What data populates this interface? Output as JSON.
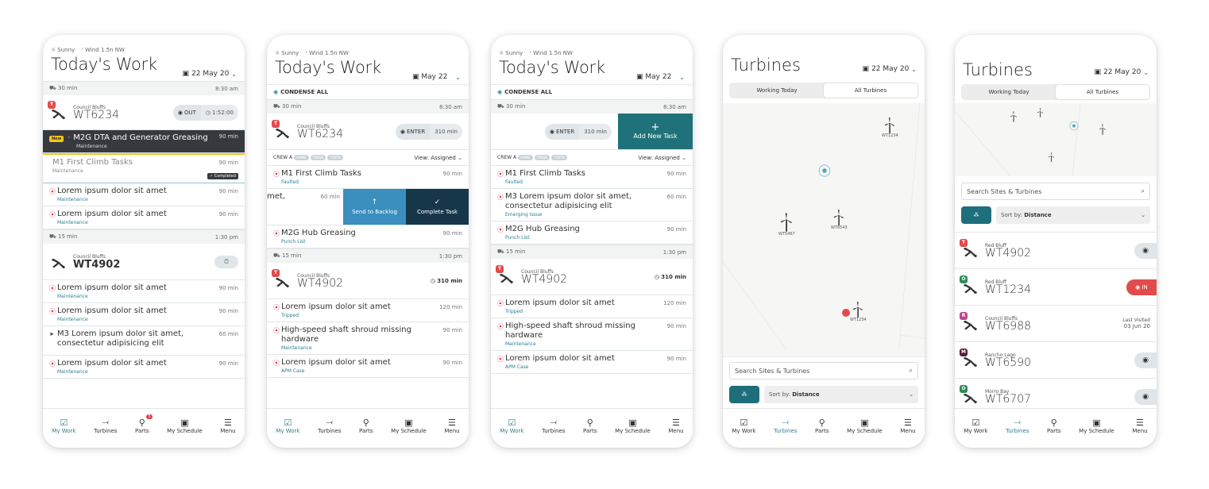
{
  "weather": {
    "condition": "Sunny",
    "wind": "Wind 1.5n NW"
  },
  "nav": {
    "items": [
      {
        "label": "My Work",
        "icon": "check-square-icon"
      },
      {
        "label": "Turbines",
        "icon": "turbine-icon"
      },
      {
        "label": "Parts",
        "icon": "wrench-icon",
        "badge": "5"
      },
      {
        "label": "My Schedule",
        "icon": "calendar-icon"
      },
      {
        "label": "Menu",
        "icon": "menu-icon"
      }
    ]
  },
  "screen1": {
    "title": "Today's Work",
    "date": "22 May 20",
    "travel1": {
      "duration": "30 min",
      "time": "8:30 am"
    },
    "turbine1": {
      "tag": "T",
      "site": "Council Bluffs",
      "id": "WT6234",
      "status": "OUT",
      "timer": "1:52:00"
    },
    "new_task": {
      "badge": "New",
      "name": "M2G DTA and Generator Greasing",
      "category": "Maintenance",
      "duration": "90 min"
    },
    "done_task": {
      "name": "M1 First Climb Tasks",
      "category": "Maintenance",
      "duration": "90 min",
      "status": "Completed"
    },
    "tasks_a": [
      {
        "name": "Lorem ipsum dolor sit amet",
        "category": "Maintenance",
        "duration": "90 min"
      },
      {
        "name": "Lorem ipsum dolor sit amet",
        "category": "Maintenance",
        "duration": "90 min"
      }
    ],
    "travel2": {
      "duration": "15 min",
      "time": "1:30 pm"
    },
    "turbine2": {
      "site": "Council Bluffs",
      "id": "WT4902"
    },
    "tasks_b": [
      {
        "name": "Lorem ipsum dolor sit amet",
        "category": "Maintenance",
        "duration": "90 min"
      },
      {
        "name": "Lorem ipsum dolor sit amet",
        "category": "Maintenance",
        "duration": "90 min"
      },
      {
        "name": "M3 Lorem ipsum dolor sit amet, consectetur adipisicing elit",
        "category": "",
        "duration": "60 min"
      },
      {
        "name": "Lorem ipsum dolor sit amet",
        "category": "Maintenance",
        "duration": "90 min"
      }
    ]
  },
  "screen2": {
    "title": "Today's Work",
    "date": "May 22",
    "condense": "CONDENSE ALL",
    "travel1": {
      "duration": "30 min",
      "time": "8:30 am"
    },
    "turbine1": {
      "tag": "T",
      "site": "Council Bluffs",
      "id": "WT6234",
      "action": "ENTER",
      "duration": "310 min"
    },
    "crew": {
      "label": "CREW A",
      "members": [
        "ANNIE",
        "FREDB",
        "TONYB"
      ],
      "view": "View: Assigned"
    },
    "task1": {
      "name": "M1 First Climb Tasks",
      "category": "Faulted",
      "duration": "90 min"
    },
    "swipe": {
      "text": "met,",
      "duration": "60 min",
      "backlog": "Send to Backlog",
      "complete": "Complete Task"
    },
    "task3": {
      "name": "M2G Hub Greasing",
      "category": "Punch List",
      "duration": "90 min"
    },
    "travel2": {
      "duration": "15 min",
      "time": "1:30 pm"
    },
    "turbine2": {
      "tag": "T",
      "site": "Council Bluffs",
      "id": "WT4902",
      "duration": "310 min"
    },
    "tasks_b": [
      {
        "name": "Lorem ipsum dolor sit amet",
        "category": "Tripped",
        "duration": "120 min"
      },
      {
        "name": "High-speed shaft shroud missing hardware",
        "category": "Maintenance",
        "duration": "90 min"
      },
      {
        "name": "Lorem ipsum dolor sit amet",
        "category": "APM Case",
        "duration": "90 min"
      }
    ]
  },
  "screen3": {
    "title": "Today's Work",
    "date": "May 22",
    "condense": "CONDENSE ALL",
    "travel1": {
      "duration": "30 min",
      "time": "8:30 am"
    },
    "turbine1": {
      "action": "ENTER",
      "duration": "310 min",
      "add_task": "Add New Task"
    },
    "crew": {
      "label": "CREW A",
      "members": [
        "ANNIE",
        "FREDB",
        "TONYB"
      ],
      "view": "View: Assigned"
    },
    "tasks_a": [
      {
        "name": "M1 First Climb Tasks",
        "category": "Faulted",
        "duration": "90 min"
      },
      {
        "name": "M3 Lorem ipsum dolor sit amet, consectetur adipisicing elit",
        "category": "Emerging Issue",
        "duration": "60 min"
      },
      {
        "name": "M2G Hub Greasing",
        "category": "Punch List",
        "duration": "90 min"
      }
    ],
    "travel2": {
      "duration": "15 min",
      "time": "1:30 pm"
    },
    "turbine2": {
      "tag": "T",
      "site": "Council Bluffs",
      "id": "WT4902",
      "duration": "310 min"
    },
    "tasks_b": [
      {
        "name": "Lorem ipsum dolor sit amet",
        "category": "Tripped",
        "duration": "120 min"
      },
      {
        "name": "High-speed shaft shroud missing hardware",
        "category": "Maintenance",
        "duration": "90 min"
      },
      {
        "name": "Lorem ipsum dolor sit amet",
        "category": "APM Case",
        "duration": "90 min"
      }
    ]
  },
  "screen4": {
    "title": "Turbines",
    "date": "22 May 20",
    "tabs": [
      "Working Today",
      "All Turbines"
    ],
    "markers": [
      "WT1234",
      "WT5467",
      "WT6543",
      "WT1234"
    ],
    "search_placeholder": "Search Sites & Turbines",
    "sort_label": "Sort by:",
    "sort_value": "Distance"
  },
  "screen5": {
    "title": "Turbines",
    "date": "22 May 20",
    "tabs": [
      "Working Today",
      "All Turbines"
    ],
    "search_placeholder": "Search Sites & Turbines",
    "sort_label": "Sort by:",
    "sort_value": "Distance",
    "list": [
      {
        "tag": "T",
        "tag_color": "#e24b4b",
        "site": "Red Bluff",
        "id": "WT4902",
        "right": "gray"
      },
      {
        "tag": "O",
        "tag_color": "#2e8a57",
        "site": "Red Bluff",
        "id": "WT1234",
        "right": "in",
        "in_label": "IN"
      },
      {
        "tag": "R",
        "tag_color": "#b8468f",
        "site": "Council Bluffs",
        "id": "WT6988",
        "right": "visit",
        "visit_label": "Last Visited",
        "visit_date": "03 Jun 20"
      },
      {
        "tag": "M",
        "tag_color": "#5a1d3c",
        "site": "Rancho Lago",
        "id": "WT6590",
        "right": "gray"
      },
      {
        "tag": "O",
        "tag_color": "#2e8a57",
        "site": "Morro Bay",
        "id": "WT6707",
        "right": "gray"
      }
    ]
  },
  "colors": {
    "accent": "#2a7f92",
    "red": "#e24b4b",
    "dark": "#36393d",
    "backlog": "#3a8fbf",
    "complete": "#16374a",
    "add": "#20727a"
  }
}
